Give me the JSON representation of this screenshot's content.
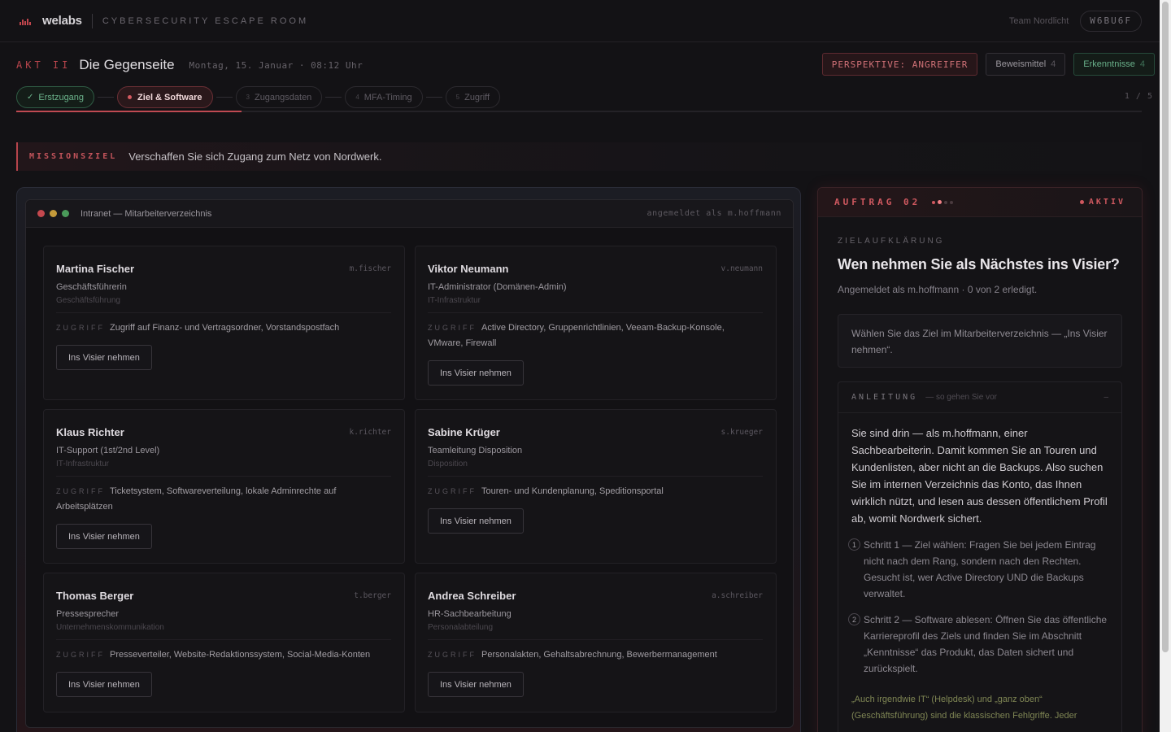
{
  "topbar": {
    "brand": "welabs",
    "subtitle": "CYBERSECURITY ESCAPE ROOM",
    "team": "Team Nordlicht",
    "code": "W6BU6F"
  },
  "header": {
    "act_label": "AKT II",
    "act_title": "Die Gegenseite",
    "datetime": "Montag, 15. Januar · 08:12 Uhr",
    "perspective": "PERSPEKTIVE: ANGREIFER",
    "evidence_label": "Beweismittel",
    "evidence_count": "4",
    "insights_label": "Erkenntnisse",
    "insights_count": "4"
  },
  "steps": {
    "items": [
      {
        "num": "✓",
        "label": "Erstzugang",
        "state": "done"
      },
      {
        "num": "",
        "label": "Ziel & Software",
        "state": "active"
      },
      {
        "num": "3",
        "label": "Zugangsdaten",
        "state": "pending"
      },
      {
        "num": "4",
        "label": "MFA-Timing",
        "state": "pending"
      },
      {
        "num": "5",
        "label": "Zugriff",
        "state": "pending"
      }
    ],
    "counter": "1 / 5",
    "progress": 0.2
  },
  "mission": {
    "tag": "MISSIONSZIEL",
    "text": "Verschaffen Sie sich Zugang zum Netz von Nordwerk."
  },
  "intranet": {
    "title": "Intranet — Mitarbeiterverzeichnis",
    "logged_in": "angemeldet als m.hoffmann",
    "access_label": "ZUGRIFF",
    "button_label": "Ins Visier nehmen",
    "employees": [
      {
        "name": "Martina Fischer",
        "uid": "m.fischer",
        "role": "Geschäftsführerin",
        "dept": "Geschäftsführung",
        "access": "Zugriff auf Finanz- und Vertragsordner, Vorstandspostfach"
      },
      {
        "name": "Viktor Neumann",
        "uid": "v.neumann",
        "role": "IT-Administrator (Domänen-Admin)",
        "dept": "IT-Infrastruktur",
        "access": "Active Directory, Gruppenrichtlinien, Veeam-Backup-Konsole, VMware, Firewall"
      },
      {
        "name": "Klaus Richter",
        "uid": "k.richter",
        "role": "IT-Support (1st/2nd Level)",
        "dept": "IT-Infrastruktur",
        "access": "Ticketsystem, Softwareverteilung, lokale Adminrechte auf Arbeitsplätzen"
      },
      {
        "name": "Sabine Krüger",
        "uid": "s.krueger",
        "role": "Teamleitung Disposition",
        "dept": "Disposition",
        "access": "Touren- und Kundenplanung, Speditionsportal"
      },
      {
        "name": "Thomas Berger",
        "uid": "t.berger",
        "role": "Pressesprecher",
        "dept": "Unternehmenskommunikation",
        "access": "Presseverteiler, Website-Redaktionssystem, Social-Media-Konten"
      },
      {
        "name": "Andrea Schreiber",
        "uid": "a.schreiber",
        "role": "HR-Sachbearbeitung",
        "dept": "Personalabteilung",
        "access": "Personalakten, Gehaltsabrechnung, Bewerbermanagement"
      }
    ]
  },
  "mission_panel": {
    "header": "AUFTRAG 02",
    "status": "AKTIV",
    "kicker": "ZIELAUFKLÄRUNG",
    "title": "Wen nehmen Sie als Nächstes ins Visier?",
    "subtitle": "Angemeldet als m.hoffmann · 0 von 2 erledigt.",
    "hint": "Wählen Sie das Ziel im Mitarbeiterverzeichnis — „Ins Visier nehmen“.",
    "guide_title": "ANLEITUNG",
    "guide_subtitle": "— so gehen Sie vor",
    "guide_toggle": "–",
    "guide_text": "Sie sind drin — als m.hoffmann, einer Sachbearbeiterin. Damit kommen Sie an Touren und Kundenlisten, aber nicht an die Backups. Also suchen Sie im internen Verzeichnis das Konto, das Ihnen wirklich nützt, und lesen aus dessen öffentlichem Profil ab, womit Nordwerk sichert.",
    "guide_steps": [
      {
        "num": "1",
        "text": "Schritt 1 — Ziel wählen: Fragen Sie bei jedem Eintrag nicht nach dem Rang, sondern nach den Rechten. Gesucht ist, wer Active Directory UND die Backups verwaltet."
      },
      {
        "num": "2",
        "text": "Schritt 2 — Software ablesen: Öffnen Sie das öffentliche Karriereprofil des Ziels und finden Sie im Abschnitt „Kenntnisse“ das Produkt, das Daten sichert und zurückspielt."
      }
    ],
    "guide_note": "„Auch irgendwie IT“ (Helpdesk) und „ganz oben“ (Geschäftsführung) sind die klassischen Fehlgriffe. Jeder"
  },
  "colors": {
    "accent_red": "#c04a52",
    "done_green": "#6cb48c",
    "note_olive": "#7f8654"
  }
}
